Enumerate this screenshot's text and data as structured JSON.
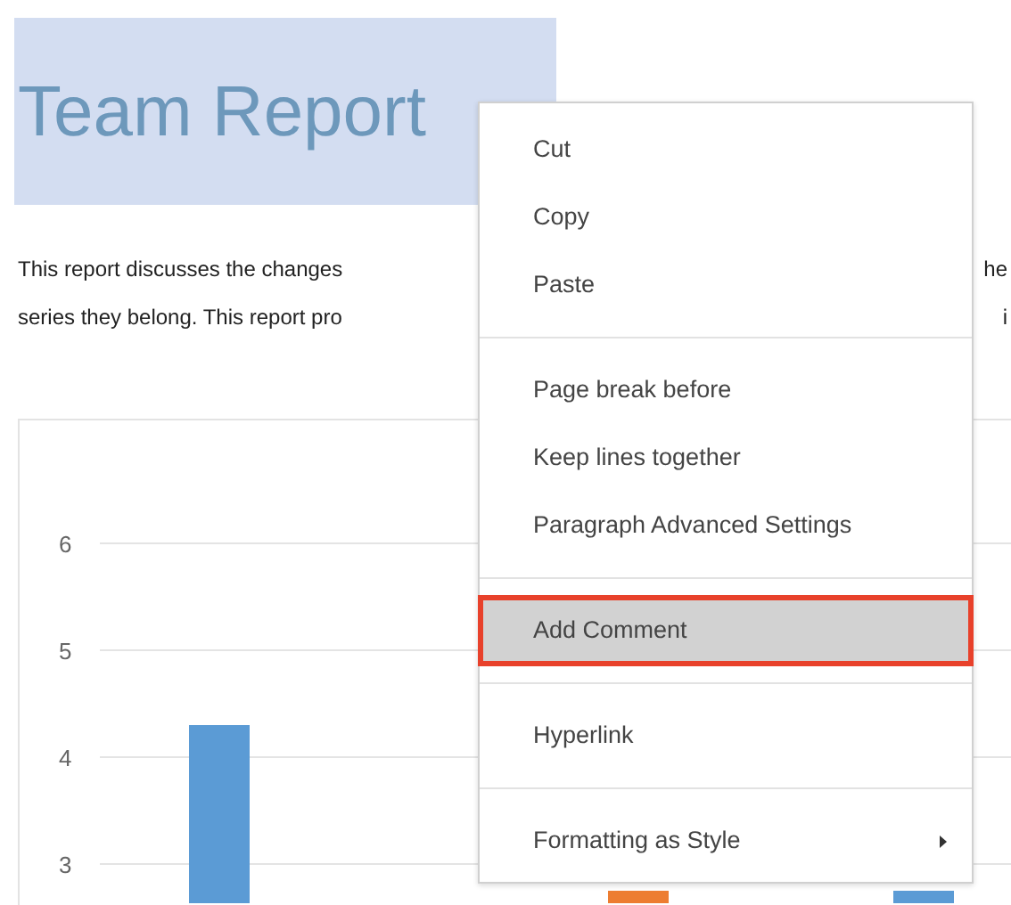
{
  "heading": "Team Report",
  "paragraph_lines": [
    {
      "left": "This report discusses the changes",
      "right": "he"
    },
    {
      "left": "series they belong. This report pro",
      "right": "i"
    }
  ],
  "chart": {
    "chart_data": {
      "type": "bar",
      "yticks": [
        3,
        4,
        5,
        6
      ],
      "ylim": [
        2.6,
        6
      ],
      "grid": true,
      "series": [
        {
          "color": "#5b9bd5",
          "values": [
            4.3,
            null,
            2.75
          ]
        },
        {
          "color": "#ed7d31",
          "values": [
            null,
            2.75,
            null
          ]
        }
      ]
    }
  },
  "context_menu": {
    "items": [
      {
        "kind": "item",
        "label": "Cut",
        "selected": false
      },
      {
        "kind": "item",
        "label": "Copy",
        "selected": false
      },
      {
        "kind": "item",
        "label": "Paste",
        "selected": false
      },
      {
        "kind": "separator"
      },
      {
        "kind": "item",
        "label": "Page break before",
        "selected": false
      },
      {
        "kind": "item",
        "label": "Keep lines together",
        "selected": false
      },
      {
        "kind": "item",
        "label": "Paragraph Advanced Settings",
        "selected": false
      },
      {
        "kind": "separator"
      },
      {
        "kind": "item",
        "label": "Add Comment",
        "selected": true
      },
      {
        "kind": "separator"
      },
      {
        "kind": "item",
        "label": "Hyperlink",
        "selected": false
      },
      {
        "kind": "separator"
      },
      {
        "kind": "submenu",
        "label": "Formatting as Style",
        "selected": false
      }
    ]
  }
}
